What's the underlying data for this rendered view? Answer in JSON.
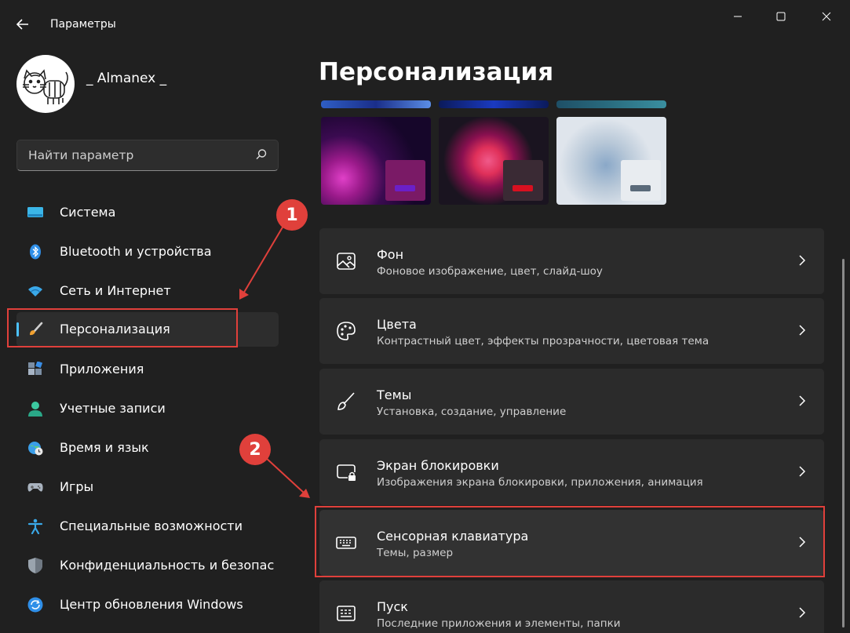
{
  "window": {
    "title": "Параметры"
  },
  "user": {
    "name": "_ Almanex _"
  },
  "search": {
    "placeholder": "Найти параметр"
  },
  "sidebar": {
    "items": [
      {
        "label": "Система",
        "icon": "monitor-icon"
      },
      {
        "label": "Bluetooth и устройства",
        "icon": "bluetooth-icon"
      },
      {
        "label": "Сеть и Интернет",
        "icon": "wifi-icon"
      },
      {
        "label": "Персонализация",
        "icon": "brush-icon",
        "selected": true
      },
      {
        "label": "Приложения",
        "icon": "apps-icon"
      },
      {
        "label": "Учетные записи",
        "icon": "person-icon"
      },
      {
        "label": "Время и язык",
        "icon": "globe-clock-icon"
      },
      {
        "label": "Игры",
        "icon": "gamepad-icon"
      },
      {
        "label": "Специальные возможности",
        "icon": "accessibility-icon"
      },
      {
        "label": "Конфиденциальность и безопас",
        "icon": "shield-icon"
      },
      {
        "label": "Центр обновления Windows",
        "icon": "update-icon"
      }
    ]
  },
  "main": {
    "title": "Персонализация",
    "cards": [
      {
        "title": "Фон",
        "subtitle": "Фоновое изображение, цвет, слайд-шоу",
        "icon": "image-icon"
      },
      {
        "title": "Цвета",
        "subtitle": "Контрастный цвет, эффекты прозрачности, цветовая тема",
        "icon": "palette-icon"
      },
      {
        "title": "Темы",
        "subtitle": "Установка, создание, управление",
        "icon": "brush-pen-icon"
      },
      {
        "title": "Экран блокировки",
        "subtitle": "Изображения экрана блокировки, приложения, анимация",
        "icon": "lock-screen-icon"
      },
      {
        "title": "Сенсорная клавиатура",
        "subtitle": "Темы, размер",
        "icon": "keyboard-icon"
      },
      {
        "title": "Пуск",
        "subtitle": "Последние приложения и элементы, папки",
        "icon": "start-icon"
      }
    ]
  },
  "annotations": {
    "badge1": "1",
    "badge2": "2",
    "color": "#e0403b"
  },
  "colors": {
    "accent": "#4cc2ff",
    "background": "#202020",
    "card": "#2b2b2b"
  }
}
